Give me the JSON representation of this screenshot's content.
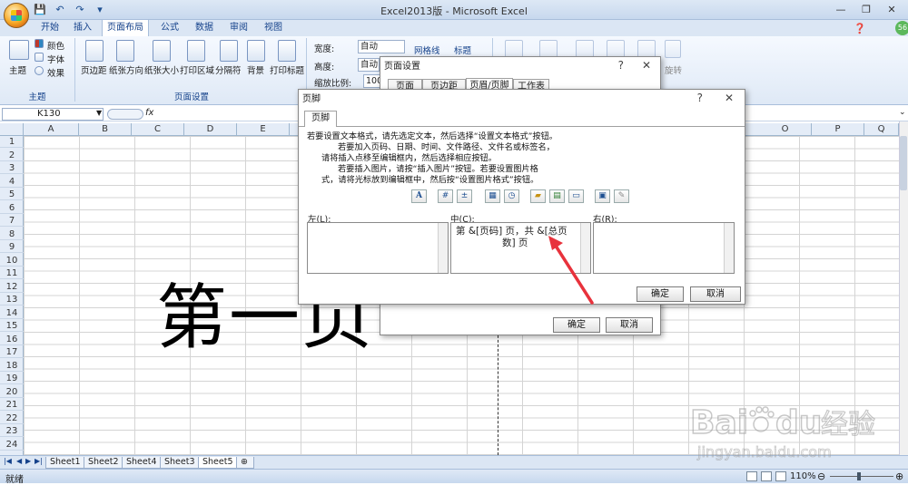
{
  "window": {
    "title": "Excel2013版 - Microsoft Excel"
  },
  "qat": {
    "save": "save-icon",
    "undo": "undo-icon",
    "redo": "redo-icon"
  },
  "tabs": [
    "开始",
    "插入",
    "页面布局",
    "公式",
    "数据",
    "审阅",
    "视图"
  ],
  "active_tab": "页面布局",
  "ribbon": {
    "theme_group": {
      "label": "主题",
      "theme": "主题",
      "colors": "颜色",
      "fonts": "字体",
      "effects": "效果"
    },
    "page_setup_group": {
      "label": "页面设置",
      "items": [
        "页边距",
        "纸张方向",
        "纸张大小",
        "打印区域",
        "分隔符",
        "背景",
        "打印标题"
      ]
    },
    "scale": {
      "width_label": "宽度:",
      "width_value": "自动",
      "height_label": "高度:",
      "height_value": "自动",
      "zoom_label": "缩放比例:",
      "zoom_value": "100"
    },
    "sheet_options": {
      "gridlines": "网格线",
      "headings": "标题"
    },
    "arrange_rotate": "旋转"
  },
  "formula_bar": {
    "name_box": "K130",
    "fx": "fx"
  },
  "columns": [
    "A",
    "B",
    "C",
    "D",
    "E",
    "O",
    "P",
    "Q"
  ],
  "rows": [
    "1",
    "2",
    "3",
    "4",
    "5",
    "6",
    "7",
    "8",
    "9",
    "10",
    "11",
    "12",
    "13",
    "14",
    "15",
    "16",
    "17",
    "18",
    "19",
    "20",
    "21",
    "22",
    "23",
    "24"
  ],
  "cell_big_text": "第一页",
  "sheets": [
    "Sheet1",
    "Sheet2",
    "Sheet4",
    "Sheet3",
    "Sheet5"
  ],
  "active_sheet": "Sheet5",
  "status": {
    "ready": "就绪",
    "zoom": "110%"
  },
  "page_setup_dialog": {
    "title": "页面设置",
    "help": "?",
    "tabs": [
      "页面",
      "页边距",
      "页眉/页脚",
      "工作表"
    ],
    "ok": "确定",
    "cancel": "取消"
  },
  "footer_dialog": {
    "title": "页脚",
    "help": "?",
    "tab": "页脚",
    "instructions": [
      "若要设置文本格式，请先选定文本，然后选择“设置文本格式”按钮。",
      "若要加入页码、日期、时间、文件路径、文件名或标签名，",
      "请将插入点移至编辑框内，然后选择相应按钮。",
      "若要插入图片，请按“插入图片”按钮。若要设置图片格",
      "式，请将光标放到编辑框中，然后按“设置图片格式”按钮。"
    ],
    "toolbar": [
      "A",
      "page-number-icon",
      "page-count-icon",
      "date-icon",
      "time-icon",
      "file-path-icon",
      "file-name-icon",
      "sheet-name-icon",
      "insert-picture-icon",
      "format-picture-icon"
    ],
    "left_label": "左(L):",
    "center_label": "中(C):",
    "right_label": "右(R):",
    "center_line1": "第 &[页码] 页，共 &[总页",
    "center_line2": "数] 页",
    "ok": "确定",
    "cancel": "取消"
  },
  "watermark": {
    "brand": "Bai",
    "brand2": "du",
    "cn": "经验",
    "url": "jingyan.baidu.com"
  },
  "colors": {
    "arrow": "#e8323c",
    "ribbon_text": "#15428b"
  }
}
